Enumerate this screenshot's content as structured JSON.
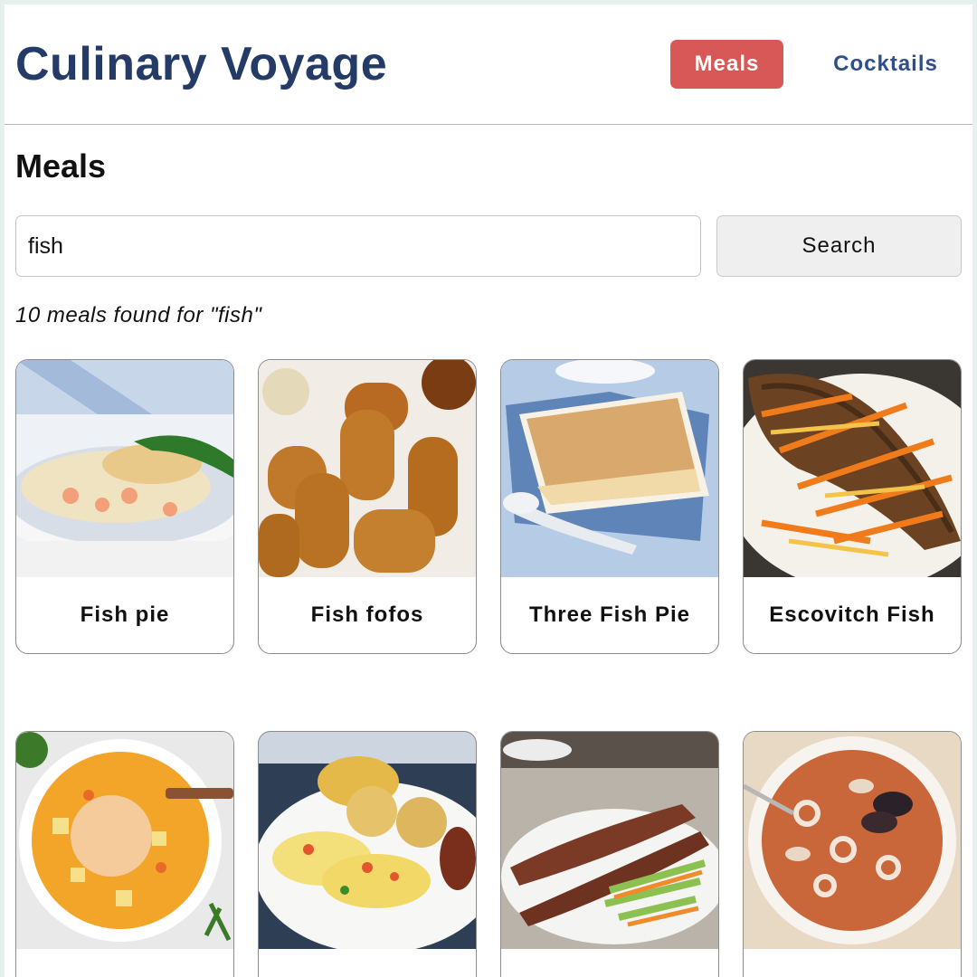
{
  "header": {
    "app_title": "Culinary Voyage",
    "nav": [
      {
        "label": "Meals",
        "active": true
      },
      {
        "label": "Cocktails",
        "active": false
      }
    ]
  },
  "page": {
    "heading": "Meals",
    "search": {
      "value": "fish",
      "button_label": "Search"
    },
    "result_count": "10 meals found for \"fish\""
  },
  "meals": [
    {
      "title": "Fish pie",
      "image": "fish-pie-photo"
    },
    {
      "title": "Fish fofos",
      "image": "fish-fofos-photo"
    },
    {
      "title": "Three Fish Pie",
      "image": "three-fish-pie-photo"
    },
    {
      "title": "Escovitch Fish",
      "image": "escovitch-fish-photo"
    },
    {
      "title": "",
      "image": "fish-soup-photo"
    },
    {
      "title": "",
      "image": "ackee-saltfish-photo"
    },
    {
      "title": "",
      "image": "grilled-fish-photo"
    },
    {
      "title": "",
      "image": "seafood-stew-photo"
    }
  ],
  "colors": {
    "brand": "#233b66",
    "accent": "#d85858",
    "link": "#2f4f8a",
    "page_bg": "#e6f0ef"
  }
}
